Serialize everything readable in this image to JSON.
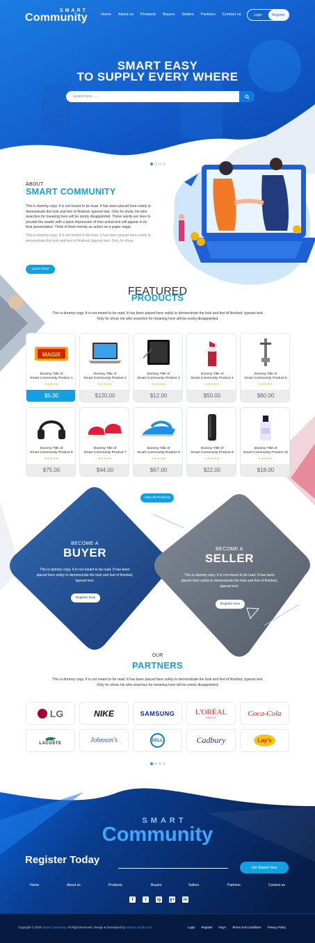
{
  "brand": {
    "line1": "SMART",
    "line2": "Community"
  },
  "nav": {
    "items": [
      "Home",
      "About us",
      "Products",
      "Buyers",
      "Sellers",
      "Partners",
      "Contact us"
    ],
    "login": "Login",
    "register": "Register"
  },
  "hero": {
    "title_line1": "SMART EASY",
    "title_line2": "TO SUPPLY EVERY WHERE",
    "search_placeholder": "Search here........",
    "slides": 4,
    "active_slide": 1
  },
  "about": {
    "label": "ABOUT",
    "title": "SMART COMMUNITY",
    "para1": "This is dummy copy. It is not meant to be read. It has been placed here solely to demonstrate the look and feel of finished, typeset text. Only for show. He who searches for meaning here will be sorely disappointed. These words are here to provide the reader with a basic impression of how actual text will appear in its final presentation.  Think of them merely as actors on a paper stage.",
    "para2": "This is dummy copy. It is not meant to be read. It has been placed here solely to demonstrate the look and feel of finished, typeset text. Only for show.",
    "button": "Learn More"
  },
  "products": {
    "label": "FEATURED",
    "title": "PRODUCTS",
    "intro": "This is dummy copy. It is not meant to be read. It has been placed here solely to demonstrate the look and feel of finished, typeset text. Only for show. He who searches for meaning here will be sorely disappointed.",
    "items": [
      {
        "t1": "Dummy Title of",
        "t2": "Smart Community Product 1",
        "price": "$5.00",
        "icon": "snack-bar-icon"
      },
      {
        "t1": "Dummy Title of",
        "t2": "Smart Community Product 2",
        "price": "$120.00",
        "icon": "laptop-icon"
      },
      {
        "t1": "Dummy Title of",
        "t2": "Smart Community Product 3",
        "price": "$12.00",
        "icon": "phone-screen-icon"
      },
      {
        "t1": "Dummy Title of",
        "t2": "Smart Community Product 4",
        "price": "$50.00",
        "icon": "lipstick-icon"
      },
      {
        "t1": "Dummy Title of",
        "t2": "Smart Community Product 5",
        "price": "$80.00",
        "icon": "bike-part-icon"
      },
      {
        "t1": "Dummy Title of",
        "t2": "Smart Community Product 6",
        "price": "$75.00",
        "icon": "headphones-icon"
      },
      {
        "t1": "Dummy Title of",
        "t2": "Smart Community Product 7",
        "price": "$44.00",
        "icon": "sneakers-icon"
      },
      {
        "t1": "Dummy Title of",
        "t2": "Smart Community Product 8",
        "price": "$67.00",
        "icon": "iron-icon"
      },
      {
        "t1": "Dummy Title of",
        "t2": "Smart Community Product 9",
        "price": "$22.00",
        "icon": "bottle-icon"
      },
      {
        "t1": "Dummy Title of",
        "t2": "Smart Community Product 10",
        "price": "$18.00",
        "icon": "cosmetic-bottle-icon"
      }
    ],
    "stars": "★★★★★",
    "view_all": "View All Products"
  },
  "buyer": {
    "label": "BECOME A",
    "title": "BUYER",
    "text": "This is dummy copy. It is not meant to be read. It has been placed here solely to demonstrate the look and feel of finished, typeset text.",
    "button": "Register Now"
  },
  "seller": {
    "label": "BECOME A",
    "title": "SELLER",
    "text": "This is dummy copy. It is not meant to be read. It has been placed here solely to demonstrate the look and feel of finished, typeset text.",
    "button": "Register Now"
  },
  "partners": {
    "label": "OUR",
    "title": "PARTNERS",
    "intro": "This is dummy copy. It is not meant to be read. It has been placed here solely to demonstrate the look and feel of finished, typeset text. Only for show. He who searches for meaning here will be sorely disappointed.",
    "logos": [
      "LG",
      "NIKE",
      "SAMSUNG",
      "L'ORÉAL",
      "Coca-Cola",
      "LACOSTE",
      "Johnson's",
      "DELL",
      "Cadbury",
      "Lay's"
    ],
    "loreal_sub": "PARIS"
  },
  "footer": {
    "brand_line1": "SMART",
    "brand_line2": "Community",
    "register_title": "Register Today",
    "cta": "Get Started Now",
    "nav": [
      "Home",
      "About us",
      "Products",
      "Buyers",
      "Sellers",
      "Partners",
      "Contact us"
    ],
    "social": [
      "f",
      "t",
      "ig",
      "g+",
      "in"
    ],
    "copyright_prefix": "Copyright © 2019",
    "copyright_brand": "Smart Community.",
    "copyright_mid": "All Right Reserved. Design & Developed by",
    "copyright_dev": "Imeetcz Studio.com",
    "links": [
      "Login",
      "Register",
      "Faq's",
      "Terms And Conditions",
      "Privacy Policy"
    ]
  },
  "colors": {
    "primary": "#12a0e3",
    "dark_navy": "#0a2a63",
    "hero_blue": "#1a7fe6"
  }
}
